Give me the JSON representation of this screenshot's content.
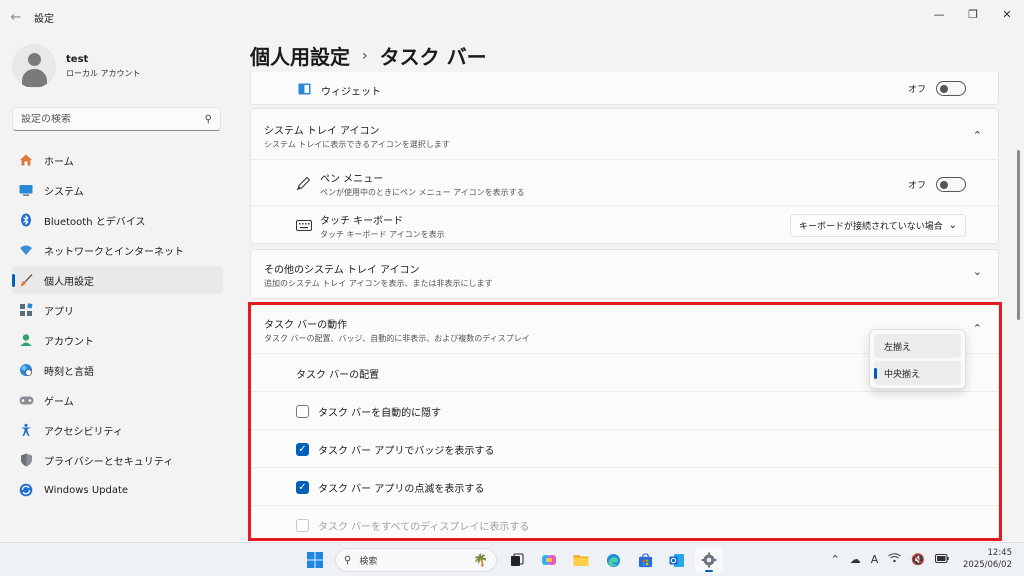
{
  "window": {
    "title": "設定",
    "back_glyph": "←",
    "minimize": "—",
    "restore": "❐",
    "close": "✕"
  },
  "profile": {
    "name": "test",
    "account_type": "ローカル アカウント"
  },
  "search": {
    "placeholder": "設定の検索",
    "icon": "search-icon"
  },
  "nav": {
    "items": [
      {
        "label": "ホーム",
        "icon": "home-icon"
      },
      {
        "label": "システム",
        "icon": "system-icon"
      },
      {
        "label": "Bluetooth とデバイス",
        "icon": "bluetooth-icon"
      },
      {
        "label": "ネットワークとインターネット",
        "icon": "network-icon"
      },
      {
        "label": "個人用設定",
        "icon": "brush-icon",
        "active": true
      },
      {
        "label": "アプリ",
        "icon": "apps-icon"
      },
      {
        "label": "アカウント",
        "icon": "account-icon"
      },
      {
        "label": "時刻と言語",
        "icon": "globe-icon"
      },
      {
        "label": "ゲーム",
        "icon": "gamepad-icon"
      },
      {
        "label": "アクセシビリティ",
        "icon": "accessibility-icon"
      },
      {
        "label": "プライバシーとセキュリティ",
        "icon": "shield-icon"
      },
      {
        "label": "Windows Update",
        "icon": "update-icon"
      }
    ]
  },
  "breadcrumb": {
    "parent": "個人用設定",
    "separator": "›",
    "current": "タスク バー"
  },
  "widgets": {
    "label": "ウィジェット",
    "state_label": "オフ"
  },
  "system_tray": {
    "title": "システム トレイ アイコン",
    "subtitle": "システム トレイに表示できるアイコンを選択します",
    "pen_menu": {
      "title": "ペン メニュー",
      "subtitle": "ペンが使用中のときにペン メニュー アイコンを表示する",
      "state_label": "オフ"
    },
    "touch_keyboard": {
      "title": "タッチ キーボード",
      "subtitle": "タッチ キーボード アイコンを表示",
      "selected": "キーボードが接続されていない場合"
    }
  },
  "other_tray": {
    "title": "その他のシステム トレイ アイコン",
    "subtitle": "追加のシステム トレイ アイコンを表示、または非表示にします"
  },
  "behaviors": {
    "title": "タスク バーの動作",
    "subtitle": "タスク バーの配置、バッジ、自動的に非表示、および複数のディスプレイ",
    "alignment_label": "タスク バーの配置",
    "alignment_options": [
      "左揃え",
      "中央揃え"
    ],
    "alignment_selected": "中央揃え",
    "auto_hide": {
      "label": "タスク バーを自動的に隠す",
      "checked": false
    },
    "badges": {
      "label": "タスク バー アプリでバッジを表示する",
      "checked": true
    },
    "flashing": {
      "label": "タスク バー アプリの点滅を表示する",
      "checked": true
    },
    "all_displays": {
      "label": "タスク バーをすべてのディスプレイに表示する",
      "checked": false,
      "disabled": true
    }
  },
  "taskbar": {
    "search_label": "検索",
    "time": "12:45",
    "date": "2025/06/02",
    "ime_label": "A"
  },
  "colors": {
    "accent": "#005fb8",
    "highlight": "#e21b23"
  }
}
